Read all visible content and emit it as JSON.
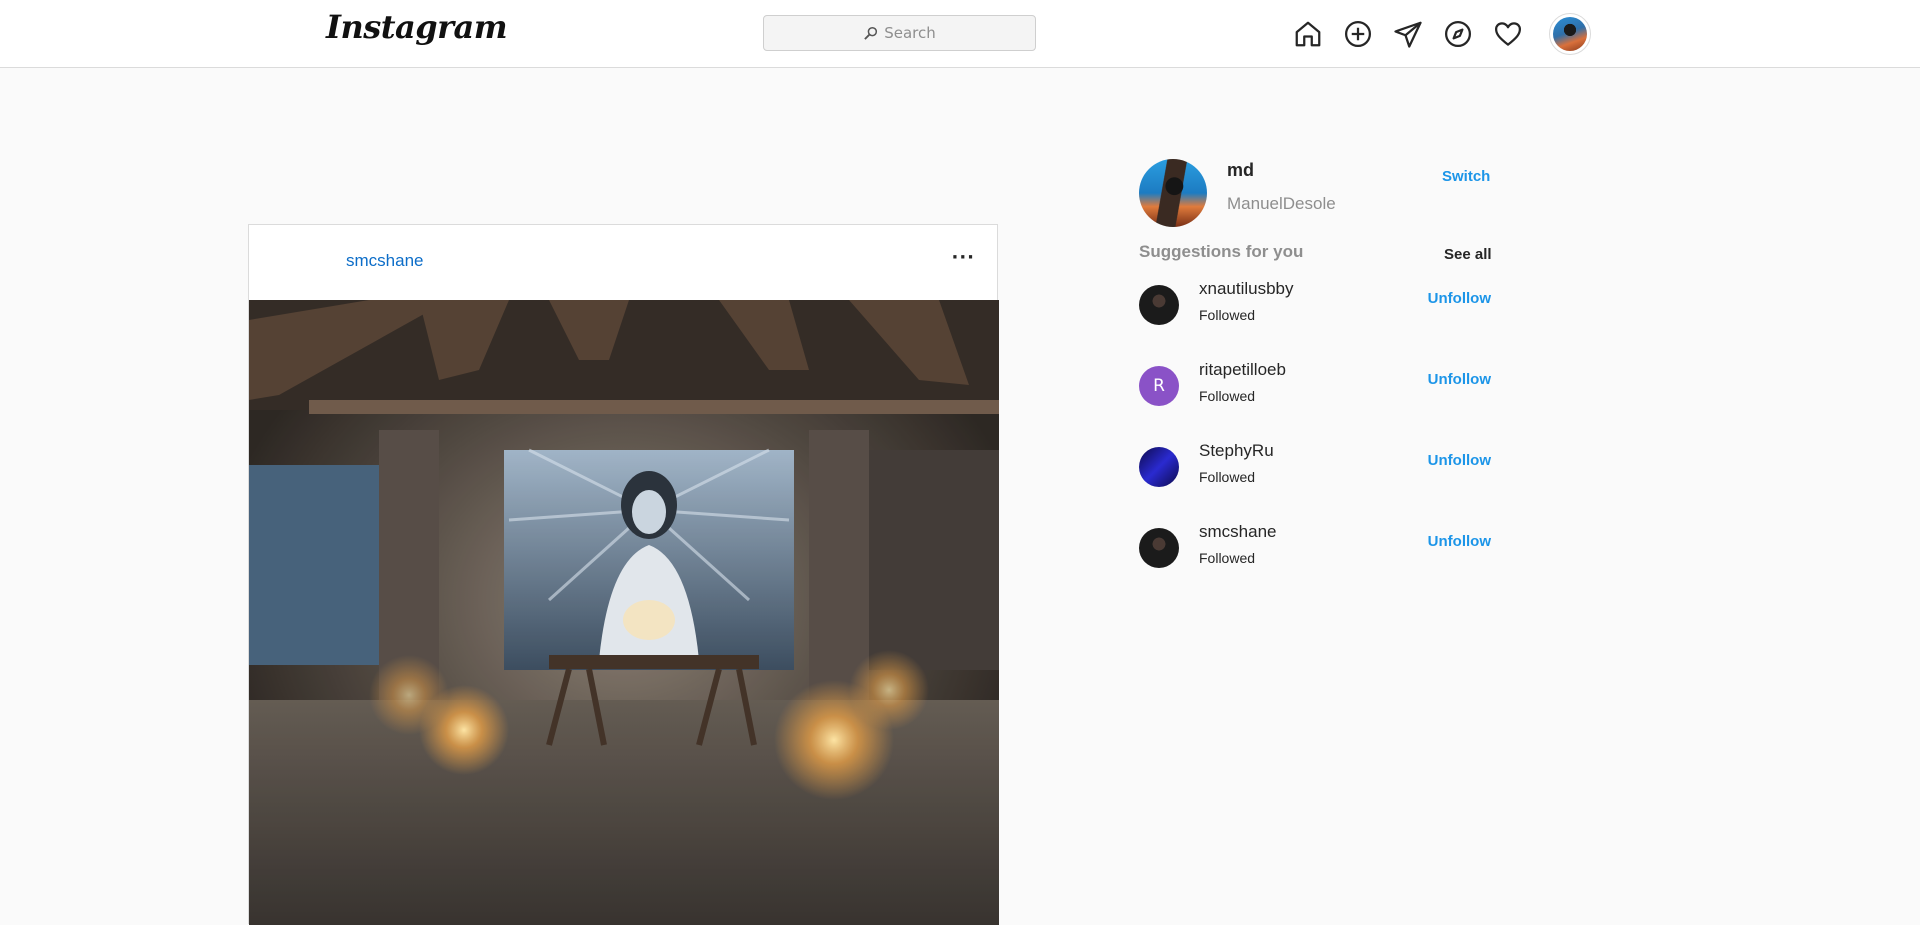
{
  "header": {
    "logo_text": "Instagram",
    "search_placeholder": "Search",
    "nav_icons": [
      "home-icon",
      "new-post-icon",
      "direct-icon",
      "explore-icon",
      "activity-icon"
    ]
  },
  "post": {
    "username": "smcshane",
    "more_label": "···"
  },
  "sidebar": {
    "me": {
      "username": "md",
      "full_name": "ManuelDesole",
      "switch_label": "Switch"
    },
    "suggestions_title": "Suggestions for you",
    "see_all_label": "See all",
    "suggestions": [
      {
        "username": "xnautilusbby",
        "status": "Followed",
        "action": "Unfollow",
        "avatar_initial": "",
        "avatar_color": "#1b1b1b"
      },
      {
        "username": "ritapetilloeb",
        "status": "Followed",
        "action": "Unfollow",
        "avatar_initial": "R",
        "avatar_color": "#8a52c7"
      },
      {
        "username": "StephyRu",
        "status": "Followed",
        "action": "Unfollow",
        "avatar_initial": "",
        "avatar_color": "#14106b"
      },
      {
        "username": "smcshane",
        "status": "Followed",
        "action": "Unfollow",
        "avatar_initial": "",
        "avatar_color": "#1b1b1b"
      }
    ]
  },
  "colors": {
    "accent": "#1c95e8",
    "border": "#dbdbdb",
    "background": "#fafafa"
  }
}
